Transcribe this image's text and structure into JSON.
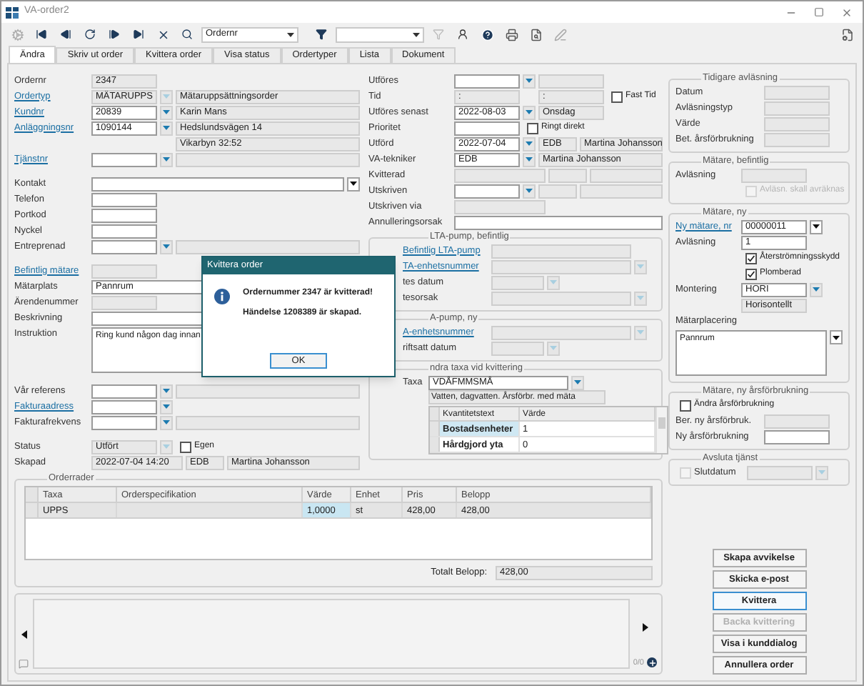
{
  "window": {
    "title": "VA-order2"
  },
  "toolbar": {
    "search_field": {
      "value": "Ordernr"
    }
  },
  "tabs": [
    {
      "label": "Ändra",
      "selected": true
    },
    {
      "label": "Skriv ut order",
      "selected": false
    },
    {
      "label": "Kvittera order",
      "selected": false
    },
    {
      "label": "Visa status",
      "selected": false
    },
    {
      "label": "Ordertyper",
      "selected": false
    },
    {
      "label": "Lista",
      "selected": false
    },
    {
      "label": "Dokument",
      "selected": false
    }
  ],
  "left_sections": [
    [
      {
        "label": "Ordernr",
        "link": false,
        "cells": [
          {
            "kind": "short",
            "value": "2347",
            "readonly": true
          }
        ]
      },
      {
        "label": "Ordertyp",
        "link": true,
        "cells": [
          {
            "kind": "short",
            "value": "MÄTARUPPS",
            "readonly": true
          },
          {
            "kind": "drop",
            "disabled": true
          },
          {
            "kind": "long",
            "value": "Mätaruppsättningsorder",
            "readonly": true
          }
        ]
      },
      {
        "label": "Kundnr",
        "link": true,
        "cells": [
          {
            "kind": "short",
            "value": "20839",
            "readonly": false
          },
          {
            "kind": "drop",
            "disabled": false
          },
          {
            "kind": "long",
            "value": "Karin Mans",
            "readonly": true
          }
        ]
      },
      {
        "label": "Anläggningsnr",
        "link": true,
        "cells": [
          {
            "kind": "short",
            "value": "1090144",
            "readonly": false
          },
          {
            "kind": "drop",
            "disabled": false
          },
          {
            "kind": "long",
            "value": "Hedslundsvägen 14",
            "readonly": true
          }
        ]
      },
      {
        "cells": [
          {
            "kind": "spacer"
          },
          {
            "kind": "blank"
          },
          {
            "kind": "long",
            "value": "Vikarbyn 32:52",
            "readonly": true
          }
        ]
      },
      {
        "label": "Tjänstnr",
        "link": true,
        "cells": [
          {
            "kind": "short",
            "readonly": false
          },
          {
            "kind": "drop",
            "disabled": false
          },
          {
            "kind": "long",
            "readonly": true
          }
        ]
      }
    ],
    [
      {
        "label": "Kontakt",
        "link": false,
        "cells": [
          {
            "kind": "long",
            "readonly": false
          },
          {
            "kind": "drop_dark"
          }
        ]
      },
      {
        "label": "Telefon",
        "link": false,
        "cells": [
          {
            "kind": "short",
            "readonly": false
          }
        ]
      },
      {
        "label": "Portkod",
        "link": false,
        "cells": [
          {
            "kind": "short",
            "readonly": false
          }
        ]
      },
      {
        "label": "Nyckel",
        "link": false,
        "cells": [
          {
            "kind": "short",
            "readonly": false
          }
        ]
      },
      {
        "label": "Entreprenad",
        "link": false,
        "cells": [
          {
            "kind": "short",
            "readonly": false
          },
          {
            "kind": "drop",
            "disabled": false
          },
          {
            "kind": "long",
            "readonly": true
          }
        ]
      }
    ],
    [
      {
        "label": "Befintlig mätare",
        "link": true,
        "cells": [
          {
            "kind": "short",
            "readonly": true
          }
        ]
      },
      {
        "label": "Mätarplats",
        "link": false,
        "cells": [
          {
            "kind": "long",
            "value": "Pannrum",
            "readonly": false
          }
        ]
      },
      {
        "label": "Ärendenummer",
        "link": false,
        "cells": [
          {
            "kind": "short",
            "readonly": true
          }
        ]
      },
      {
        "label": "Beskrivning",
        "link": false,
        "cells": [
          {
            "kind": "long",
            "readonly": false
          }
        ]
      },
      {
        "label": "Instruktion",
        "link": false,
        "cells": [
          {
            "kind": "memo",
            "value": "Ring kund någon dag innan",
            "readonly": false
          }
        ]
      }
    ],
    [
      {
        "label": "Vår referens",
        "link": false,
        "cells": [
          {
            "kind": "short",
            "readonly": false
          },
          {
            "kind": "drop",
            "disabled": false
          },
          {
            "kind": "long",
            "readonly": true
          }
        ]
      },
      {
        "label": "Fakturaadress",
        "link": true,
        "cells": [
          {
            "kind": "short",
            "readonly": false
          },
          {
            "kind": "drop",
            "disabled": false
          }
        ]
      },
      {
        "label": "Fakturafrekvens",
        "link": false,
        "cells": [
          {
            "kind": "short",
            "readonly": false
          },
          {
            "kind": "drop",
            "disabled": false
          },
          {
            "kind": "long",
            "readonly": true
          }
        ]
      }
    ],
    [
      {
        "label": "Status",
        "link": false,
        "cells": [
          {
            "kind": "short",
            "value": "Utfört",
            "readonly": true
          },
          {
            "kind": "drop",
            "disabled": true
          },
          {
            "kind": "check",
            "label": "Egen",
            "checked": false,
            "disabled": false
          }
        ]
      },
      {
        "label": "Skapad",
        "link": false,
        "cells": [
          {
            "kind": "medium",
            "value": "2022-07-04 14:20",
            "readonly": true
          },
          {
            "kind": "tiny",
            "value": "EDB",
            "readonly": true
          },
          {
            "kind": "long",
            "value": "Martina Johansson",
            "readonly": true
          }
        ]
      }
    ]
  ],
  "middle_rows": [
    {
      "label": "Utföres",
      "link": false,
      "cells": [
        {
          "kind": "short",
          "readonly": false
        },
        {
          "kind": "drop",
          "disabled": false
        },
        {
          "kind": "short",
          "readonly": true
        }
      ]
    },
    {
      "label": "Tid",
      "link": false,
      "cells": [
        {
          "kind": "short",
          "value": ":",
          "readonly": true
        },
        {
          "kind": "blank"
        },
        {
          "kind": "short",
          "value": ":",
          "readonly": true
        },
        {
          "kind": "check",
          "label": "Fast Tid",
          "checked": false,
          "disabled": false
        }
      ]
    },
    {
      "label": "Utföres senast",
      "link": false,
      "cells": [
        {
          "kind": "short",
          "value": "2022-08-03",
          "readonly": false
        },
        {
          "kind": "drop",
          "disabled": false
        },
        {
          "kind": "short",
          "value": "Onsdag",
          "readonly": true
        }
      ]
    },
    {
      "label": "Prioritet",
      "link": false,
      "cells": [
        {
          "kind": "short",
          "readonly": false
        },
        {
          "kind": "check",
          "label": "Ringt direkt",
          "checked": false,
          "disabled": false
        }
      ]
    },
    {
      "label": "Utförd",
      "link": false,
      "cells": [
        {
          "kind": "short",
          "value": "2022-07-04",
          "readonly": false
        },
        {
          "kind": "drop",
          "disabled": false
        },
        {
          "kind": "tiny",
          "value": "EDB",
          "readonly": true
        },
        {
          "kind": "long",
          "value": "Martina Johansson",
          "readonly": true
        }
      ]
    },
    {
      "label": "VA-tekniker",
      "link": false,
      "cells": [
        {
          "kind": "short",
          "value": "EDB",
          "readonly": false
        },
        {
          "kind": "drop",
          "disabled": false
        },
        {
          "kind": "long",
          "value": "Martina Johansson",
          "readonly": true
        }
      ]
    },
    {
      "label": "Kvitterad",
      "link": false,
      "cells": [
        {
          "kind": "medium",
          "readonly": true
        },
        {
          "kind": "tiny",
          "readonly": true
        },
        {
          "kind": "long",
          "readonly": true
        }
      ]
    },
    {
      "label": "Utskriven",
      "link": false,
      "cells": [
        {
          "kind": "short",
          "readonly": false
        },
        {
          "kind": "drop",
          "disabled": false
        },
        {
          "kind": "tiny",
          "readonly": true
        },
        {
          "kind": "long",
          "readonly": true
        }
      ]
    },
    {
      "label": "Utskriven via",
      "link": false,
      "cells": [
        {
          "kind": "medium",
          "readonly": true
        }
      ]
    },
    {
      "label": "Annulleringsorsak",
      "link": false,
      "cells": [
        {
          "kind": "long",
          "readonly": false
        }
      ]
    }
  ],
  "middle_groups": [
    {
      "kind": "pump",
      "title": "LTA-pump, befintlig",
      "rows": [
        {
          "label": "Befintlig LTA-pump",
          "link": true,
          "cells": [
            {
              "kind": "wide",
              "readonly": true
            }
          ]
        },
        {
          "label": "TA-enhetsnummer",
          "link": true,
          "cells": [
            {
              "kind": "wide",
              "readonly": true
            },
            {
              "kind": "drop",
              "disabled": true
            }
          ]
        },
        {
          "label": "tes datum",
          "link": false,
          "cells": [
            {
              "kind": "small",
              "readonly": true
            },
            {
              "kind": "drop",
              "disabled": true
            }
          ]
        },
        {
          "label": "tesorsak",
          "link": false,
          "cells": [
            {
              "kind": "wide",
              "readonly": true
            },
            {
              "kind": "drop",
              "disabled": true
            }
          ]
        }
      ]
    },
    {
      "kind": "pump",
      "title": "A-pump, ny",
      "rows": [
        {
          "label": "A-enhetsnummer",
          "link": true,
          "cells": [
            {
              "kind": "wide",
              "readonly": true
            },
            {
              "kind": "drop",
              "disabled": true
            }
          ]
        },
        {
          "label": "riftsatt datum",
          "link": false,
          "cells": [
            {
              "kind": "small",
              "readonly": true
            },
            {
              "kind": "drop",
              "disabled": true
            }
          ]
        }
      ]
    },
    {
      "kind": "tariff",
      "title": "ndra taxa vid kvittering",
      "rows": [
        {
          "label": "Taxa",
          "link": false,
          "cells": [
            {
              "kind": "wide",
              "value": "VDÅFMMSMÅ",
              "readonly": false
            },
            {
              "kind": "drop",
              "disabled": false
            }
          ]
        }
      ],
      "note": "Vatten, dagvatten. Årsförbr. med mäta",
      "table": {
        "columns": [
          "Kvantitetstext",
          "Värde"
        ],
        "rows": [
          {
            "cells": [
              "Bostadsenheter",
              "1"
            ],
            "selected": true
          },
          {
            "cells": [
              "Hårdgjord yta",
              "0"
            ],
            "selected": false
          }
        ]
      }
    }
  ],
  "right_groups": [
    {
      "title": "Tidigare avläsning",
      "rows": [
        {
          "kind": "field",
          "label": "Datum",
          "link": false,
          "cells": [
            {
              "kind": "short",
              "readonly": true
            }
          ]
        },
        {
          "kind": "field",
          "label": "Avläsningstyp",
          "link": false,
          "cells": [
            {
              "kind": "short",
              "readonly": true
            }
          ]
        },
        {
          "kind": "field",
          "label": "Värde",
          "link": false,
          "cells": [
            {
              "kind": "short",
              "readonly": true
            }
          ]
        },
        {
          "kind": "field",
          "label": "Bet. årsförbrukning",
          "link": false,
          "cells": [
            {
              "kind": "short",
              "readonly": true
            }
          ]
        }
      ]
    },
    {
      "title": "Mätare, befintlig",
      "rows": [
        {
          "kind": "field",
          "label": "Avläsning",
          "link": false,
          "cells": [
            {
              "kind": "short",
              "readonly": true
            }
          ]
        },
        {
          "kind": "field",
          "cells": [
            {
              "kind": "check",
              "label": "Avläsn. skall avräknas",
              "checked": false,
              "disabled": true
            }
          ]
        }
      ]
    },
    {
      "title": "Mätare, ny",
      "rows": [
        {
          "kind": "field",
          "label": "Ny mätare, nr",
          "link": true,
          "cells": [
            {
              "kind": "short",
              "value": "00000011",
              "readonly": false
            },
            {
              "kind": "drop_dark"
            }
          ]
        },
        {
          "kind": "field",
          "label": "Avläsning",
          "link": false,
          "cells": [
            {
              "kind": "short",
              "value": "1",
              "readonly": false
            }
          ]
        },
        {
          "kind": "field",
          "cells": [
            {
              "kind": "check",
              "label": "Återströmningsskydd",
              "checked": true,
              "disabled": false
            }
          ]
        },
        {
          "kind": "field",
          "cells": [
            {
              "kind": "check",
              "label": "Plomberad",
              "checked": true,
              "disabled": false
            }
          ]
        },
        {
          "kind": "field",
          "label": "Montering",
          "link": false,
          "cells": [
            {
              "kind": "short",
              "value": "HORI",
              "readonly": false
            },
            {
              "kind": "drop",
              "disabled": false
            }
          ]
        },
        {
          "kind": "field",
          "cells": [
            {
              "kind": "short",
              "value": "Horisontellt",
              "readonly": true
            }
          ]
        },
        {
          "kind": "plain",
          "cells": [
            {
              "kind": "text",
              "value": "Mätarplacering"
            }
          ]
        },
        {
          "kind": "plain",
          "cells": [
            {
              "kind": "memo",
              "value": "Pannrum",
              "readonly": false
            },
            {
              "kind": "drop_dark"
            }
          ]
        }
      ]
    },
    {
      "title": "Mätare, ny årsförbrukning",
      "rows": [
        {
          "kind": "plain",
          "cells": [
            {
              "kind": "check",
              "label": "Ändra årsförbrukning",
              "checked": false,
              "disabled": false
            }
          ]
        },
        {
          "kind": "field",
          "label": "Ber. ny årsförbruk.",
          "link": false,
          "cells": [
            {
              "kind": "short",
              "readonly": true
            }
          ]
        },
        {
          "kind": "field",
          "label": "Ny årsförbrukning",
          "link": false,
          "cells": [
            {
              "kind": "short",
              "readonly": false
            }
          ]
        }
      ]
    },
    {
      "title": "Avsluta tjänst",
      "rows": [
        {
          "kind": "plain",
          "cells": [
            {
              "kind": "check",
              "checked": false,
              "disabled": true
            },
            {
              "kind": "text",
              "value": "Slutdatum"
            },
            {
              "kind": "short",
              "readonly": true
            },
            {
              "kind": "drop",
              "disabled": true
            }
          ]
        }
      ]
    }
  ],
  "buttons": [
    {
      "label": "Skapa avvikelse",
      "disabled": false,
      "focused": false
    },
    {
      "label": "Skicka e-post",
      "disabled": false,
      "focused": false
    },
    {
      "label": "Kvittera",
      "disabled": false,
      "focused": true
    },
    {
      "label": "Backa kvittering",
      "disabled": true,
      "focused": false
    },
    {
      "label": "Visa i kunddialog",
      "disabled": false,
      "focused": false
    },
    {
      "label": "Annullera order",
      "disabled": false,
      "focused": false
    }
  ],
  "order_rows": {
    "title": "Orderrader",
    "columns": [
      "Taxa",
      "Orderspecifikation",
      "Värde",
      "Enhet",
      "Pris",
      "Belopp"
    ],
    "rows": [
      {
        "selected": true,
        "cells": [
          {
            "text": "UPPS",
            "focused": false
          },
          {
            "focused": false
          },
          {
            "text": "1,0000",
            "focused": true
          },
          {
            "text": "st",
            "focused": false
          },
          {
            "text": "428,00",
            "focused": false
          },
          {
            "text": "428,00",
            "focused": false
          }
        ]
      }
    ],
    "total_label": "Totalt Belopp:",
    "total": "428,00"
  },
  "messages": {
    "counter": "0/0"
  },
  "dialog": {
    "title": "Kvittera order",
    "lines": [
      "Ordernummer 2347 är kvitterad!",
      "Händelse 1208389 är skapad."
    ],
    "button": "OK"
  }
}
